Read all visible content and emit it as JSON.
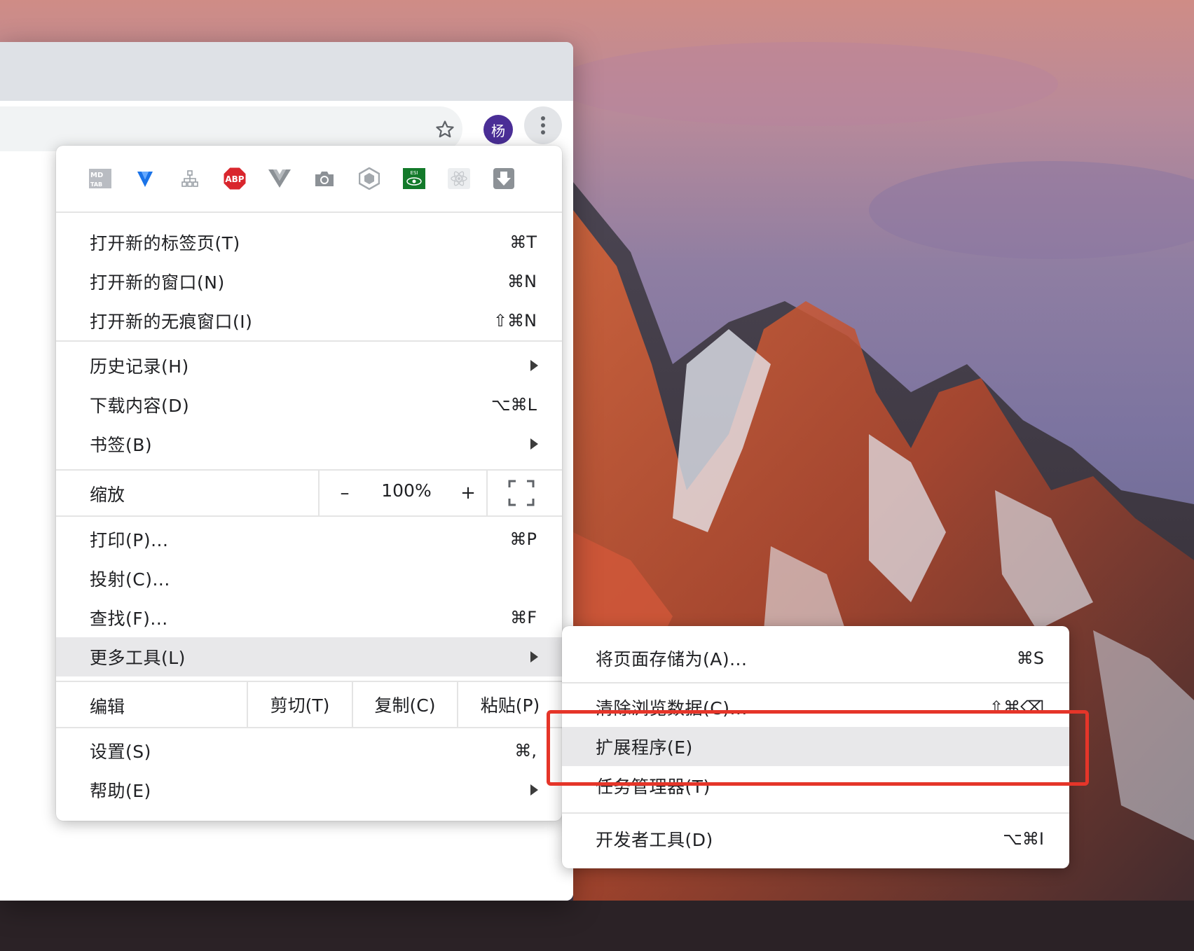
{
  "browser": {
    "profile_initial": "杨",
    "icons": {
      "star": "star-icon",
      "menu": "kebab-menu-icon"
    }
  },
  "extensions": [
    {
      "name": "mdtab-icon",
      "text": "MD TAB"
    },
    {
      "name": "vysor-icon",
      "text": ""
    },
    {
      "name": "sitemap-icon",
      "text": ""
    },
    {
      "name": "adblock-plus-icon",
      "text": "ABP"
    },
    {
      "name": "vue-devtools-icon",
      "text": ""
    },
    {
      "name": "camera-icon",
      "text": ""
    },
    {
      "name": "hexagon-icon",
      "text": ""
    },
    {
      "name": "eye-extension-icon",
      "text": "ESI"
    },
    {
      "name": "react-devtools-icon",
      "text": ""
    },
    {
      "name": "download-icon",
      "text": ""
    }
  ],
  "menu": {
    "new_tab": {
      "label": "打开新的标签页(T)",
      "shortcut": "⌘T"
    },
    "new_window": {
      "label": "打开新的窗口(N)",
      "shortcut": "⌘N"
    },
    "incognito": {
      "label": "打开新的无痕窗口(I)",
      "shortcut": "⇧⌘N"
    },
    "history": {
      "label": "历史记录(H)"
    },
    "downloads": {
      "label": "下载内容(D)",
      "shortcut": "⌥⌘L"
    },
    "bookmarks": {
      "label": "书签(B)"
    },
    "zoom": {
      "label": "缩放",
      "minus": "–",
      "value": "100%",
      "plus": "+"
    },
    "print": {
      "label": "打印(P)...",
      "shortcut": "⌘P"
    },
    "cast": {
      "label": "投射(C)..."
    },
    "find": {
      "label": "查找(F)...",
      "shortcut": "⌘F"
    },
    "more_tools": {
      "label": "更多工具(L)"
    },
    "edit": {
      "label": "编辑",
      "cut": "剪切(T)",
      "copy": "复制(C)",
      "paste": "粘贴(P)"
    },
    "settings": {
      "label": "设置(S)",
      "shortcut": "⌘,"
    },
    "help": {
      "label": "帮助(E)"
    }
  },
  "submenu": {
    "save_page": {
      "label": "将页面存储为(A)...",
      "shortcut": "⌘S"
    },
    "clear_data": {
      "label": "清除浏览数据(C)...",
      "shortcut": "⇧⌘⌫"
    },
    "extensions": {
      "label": "扩展程序(E)"
    },
    "task_manager": {
      "label": "任务管理器(T)"
    },
    "devtools": {
      "label": "开发者工具(D)",
      "shortcut": "⌥⌘I"
    }
  },
  "colors": {
    "annotation": "#e53529",
    "highlight": "#e8e8ea",
    "profile": "#4a2e96"
  }
}
